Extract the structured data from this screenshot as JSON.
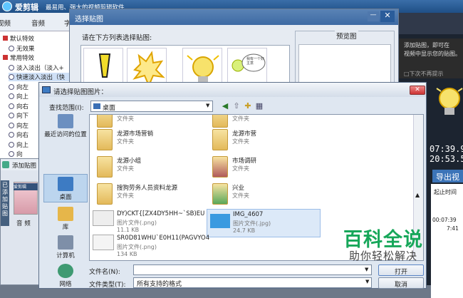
{
  "app": {
    "name": "爱剪辑",
    "slogan": "最易用、强大的视频剪辑软件"
  },
  "menubar": [
    "视频",
    "音频",
    "字"
  ],
  "effects": [
    {
      "label": "默认特效",
      "kind": "group"
    },
    {
      "label": "无效果",
      "kind": "item"
    },
    {
      "label": "常用特效",
      "kind": "group"
    },
    {
      "label": "淡入淡出（淡入+",
      "kind": "item"
    },
    {
      "label": "快速淡入淡出（快",
      "kind": "item"
    },
    {
      "label": "向左",
      "kind": "item"
    },
    {
      "label": "向上",
      "kind": "item"
    },
    {
      "label": "向右",
      "kind": "item"
    },
    {
      "label": "向下",
      "kind": "item"
    },
    {
      "label": "向左",
      "kind": "item"
    },
    {
      "label": "向右",
      "kind": "item"
    },
    {
      "label": "向上",
      "kind": "item"
    },
    {
      "label": "向",
      "kind": "item"
    }
  ],
  "right_panel": {
    "hint": "添加贴图，即可在\n视频中显示您的贴图。",
    "no_remind": "□下次不再提示",
    "time1": "07:39.9",
    "time2": "20:53.5",
    "export": "导出视",
    "table_header": "起止时间",
    "table_row1": "00:07:39",
    "table_row2": "7:41"
  },
  "sticker_dialog": {
    "title": "选择贴图",
    "instruction": "请在下方列表选择贴图:",
    "preview_label": "预览图",
    "sticker4_text": "我有一个好主意"
  },
  "add_sticker": {
    "title": "添加贴图",
    "vtab": "已添加贴图",
    "thumb_label": "爱剪辑",
    "tab_label": "音 频"
  },
  "file_dialog": {
    "title": "请选择贴图图片：",
    "lookin_label": "查找范围(I):",
    "lookin_value": "桌面",
    "places": [
      "最近访问的位置",
      "桌面",
      "库",
      "计算机",
      "网络"
    ],
    "folders": [
      {
        "name": "",
        "type": "文件夹"
      },
      {
        "name": "",
        "type": "文件夹"
      },
      {
        "name": "龙源市场营销",
        "type": "文件夹"
      },
      {
        "name": "龙源市营",
        "type": "文件夹"
      },
      {
        "name": "龙源小组",
        "type": "文件夹"
      },
      {
        "name": "市场调研",
        "type": "文件夹"
      },
      {
        "name": "搜狗劳务人员资料龙源",
        "type": "文件夹"
      },
      {
        "name": "兴业",
        "type": "文件夹"
      }
    ],
    "images": [
      {
        "name": "DY)CKT{[ZX4DY5HH~`SB)EU",
        "type": "图片文件(.png)",
        "size": "11.1 KB"
      },
      {
        "name": "IMG_4607",
        "type": "图片文件(.jpg)",
        "size": "24.7 KB"
      },
      {
        "name": "SR0D81WHU`E0H11(PAGVYO4",
        "type": "图片文件(.png)",
        "size": "134 KB"
      }
    ],
    "filename_label": "文件名(N):",
    "filename_value": "",
    "filetype_label": "文件类型(T):",
    "filetype_value": "所有支持的格式",
    "open_label": "打开",
    "cancel_label": "取消"
  },
  "watermark": {
    "title": "百科全说",
    "subtitle": "助你轻松解决"
  },
  "colors": {
    "title_blue": "#2a5c9a",
    "watermark_green": "#17a75a",
    "folder_yellow": "#e3b95a"
  }
}
